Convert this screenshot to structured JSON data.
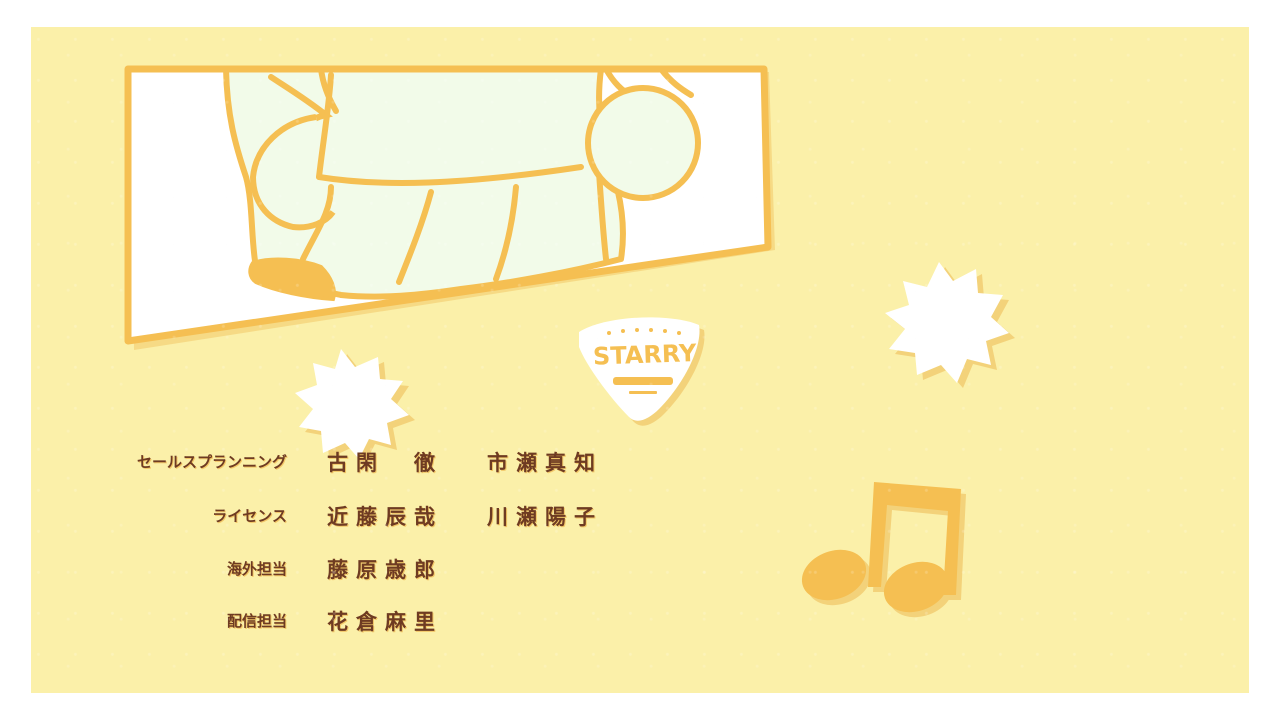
{
  "logo": {
    "text": "STARRY"
  },
  "credits": [
    {
      "role": "セールスプランニング",
      "names": [
        "古閑　徹",
        "市瀬真知"
      ]
    },
    {
      "role": "ライセンス",
      "names": [
        "近藤辰哉",
        "川瀬陽子"
      ]
    },
    {
      "role": "海外担当",
      "names": [
        "藤原歳郎"
      ]
    },
    {
      "role": "配信担当",
      "names": [
        "花倉麻里"
      ]
    }
  ],
  "colors": {
    "background": "#fbf0a9",
    "accent_orange": "#f5bf52",
    "text_brown": "#6e3b22",
    "pale_green": "#f2fbe9",
    "white": "#ffffff"
  }
}
